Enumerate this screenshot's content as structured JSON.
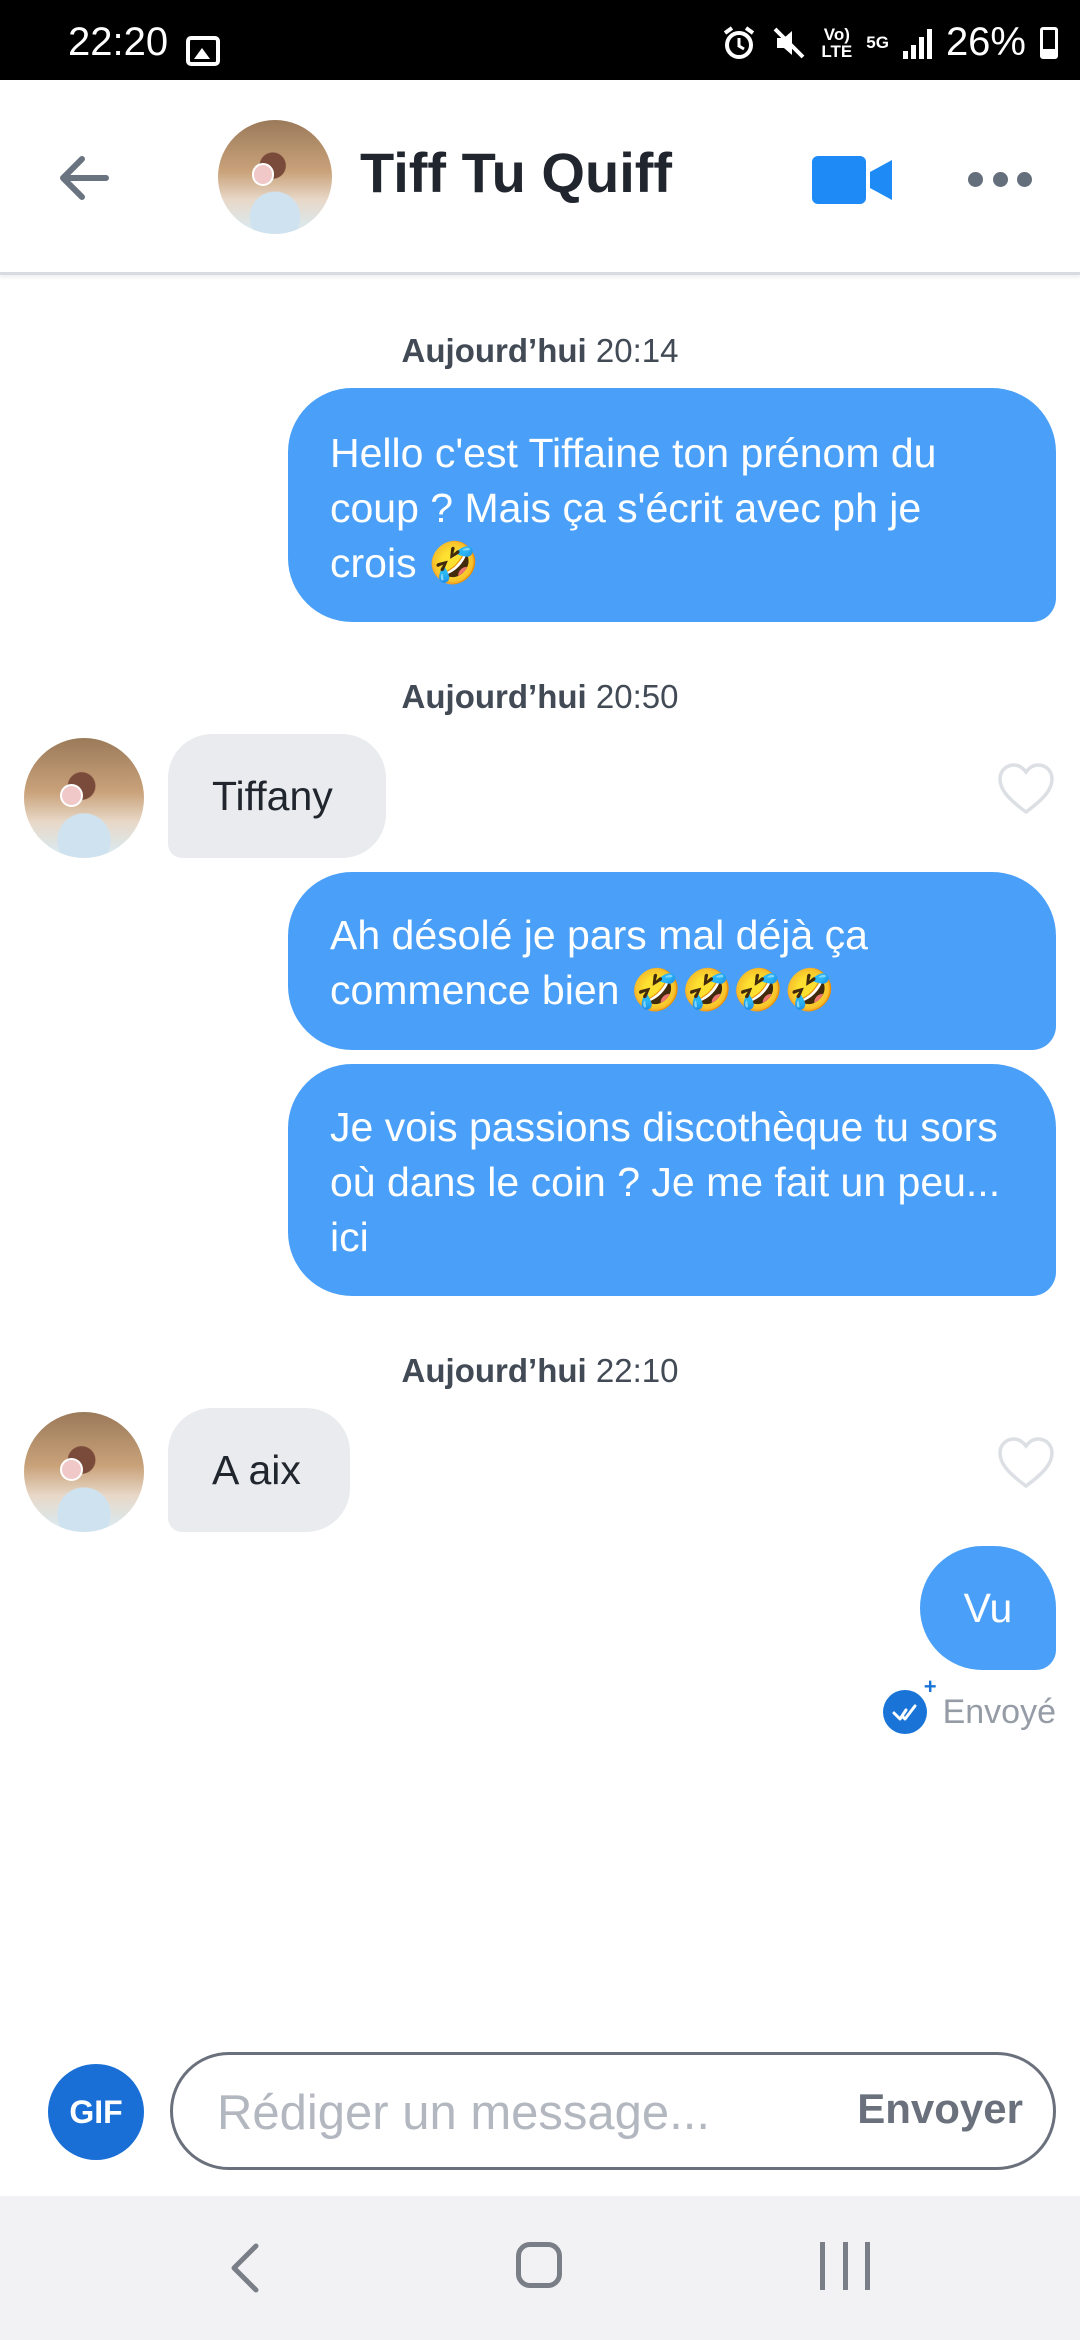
{
  "status_bar": {
    "time": "22:20",
    "volte": "Vo)\nLTE",
    "network": "5G",
    "battery": "26%",
    "icons": [
      "gallery-icon",
      "alarm-icon",
      "mute-icon",
      "volte-icon",
      "5g-icon",
      "signal-icon",
      "battery-icon"
    ]
  },
  "header": {
    "contact_name": "Tiff Tu Quiff",
    "icons": [
      "back-arrow-icon",
      "avatar",
      "video-camera-icon",
      "more-dots-icon"
    ]
  },
  "chat": {
    "stamps": [
      {
        "label": "Aujourd’hui",
        "time": "20:14"
      },
      {
        "label": "Aujourd’hui",
        "time": "20:50"
      },
      {
        "label": "Aujourd’hui",
        "time": "22:10"
      }
    ],
    "messages": [
      {
        "direction": "out",
        "text": "Hello c'est Tiffaine ton prénom du coup ? Mais ça s'écrit avec ph je crois 🤣"
      },
      {
        "direction": "in",
        "text": "Tiffany"
      },
      {
        "direction": "out",
        "text": "Ah désolé je pars mal déjà ça commence bien 🤣🤣🤣🤣"
      },
      {
        "direction": "out",
        "text": "Je vois passions discothèque tu sors où dans le coin ? Je me fait un peu... ici"
      },
      {
        "direction": "in",
        "text": "A aix"
      },
      {
        "direction": "out",
        "text": "Vu"
      }
    ],
    "delivery_status": "Envoyé",
    "accent_color": "#4aa0f8"
  },
  "composer": {
    "gif_label": "GIF",
    "placeholder": "Rédiger un message...",
    "send_label": "Envoyer"
  },
  "nav_bar": {
    "icons": [
      "nav-back-icon",
      "nav-home-icon",
      "nav-recents-icon"
    ]
  }
}
